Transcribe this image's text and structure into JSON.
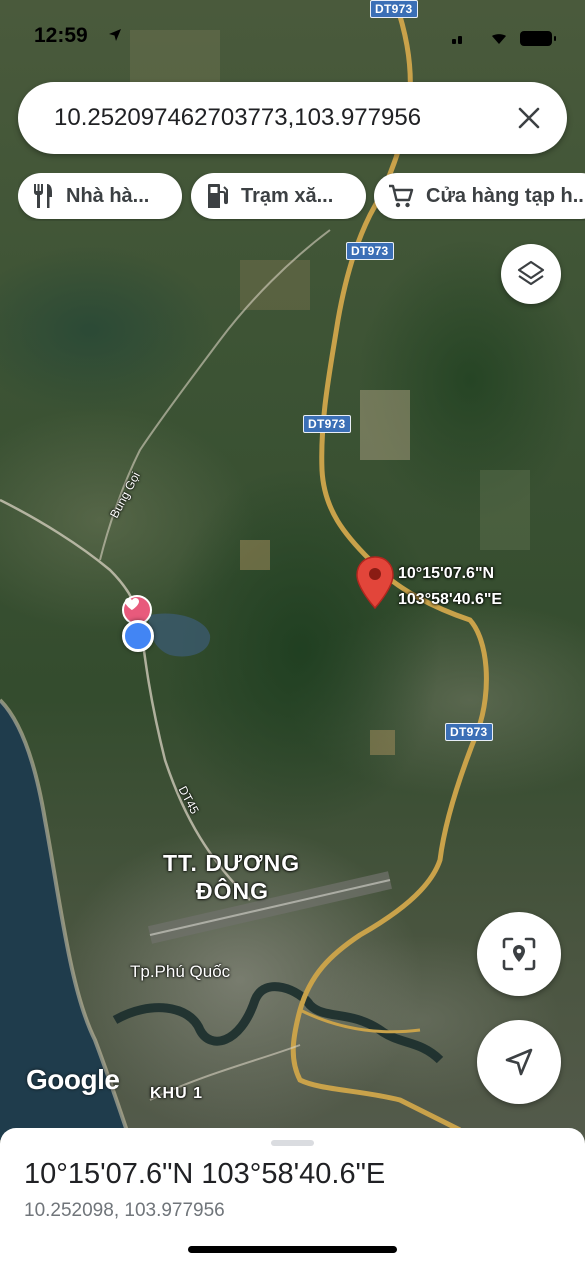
{
  "status_bar": {
    "time": "12:59"
  },
  "search": {
    "query": "10.252097462703773,103.977956"
  },
  "chips": [
    {
      "label": "Nhà hà...",
      "icon": "restaurant-icon"
    },
    {
      "label": "Trạm xă...",
      "icon": "gas-station-icon"
    },
    {
      "label": "Cửa hàng tạp h...",
      "icon": "shopping-cart-icon"
    }
  ],
  "map": {
    "road_shields": [
      "DT973",
      "DT973",
      "DT973",
      "DT973"
    ],
    "road_labels": {
      "bung_goi": "Bung Gọi",
      "dt45": "DT45"
    },
    "place_labels": {
      "town_line1": "TT. DƯƠNG",
      "town_line2": "ĐÔNG",
      "city": "Tp.Phú Quốc",
      "khu": "KHU 1"
    },
    "pin_label": {
      "lat": "10°15'07.6\"N",
      "lng": "103°58'40.6\"E"
    },
    "attribution": "Google"
  },
  "bottom_sheet": {
    "title": "10°15'07.6\"N 103°58'40.6\"E",
    "subtitle": "10.252098, 103.977956"
  },
  "colors": {
    "pin": "#e2453a",
    "my_location": "#4285f4",
    "shield": "#3b6fb6",
    "road": "#c9a24a"
  }
}
